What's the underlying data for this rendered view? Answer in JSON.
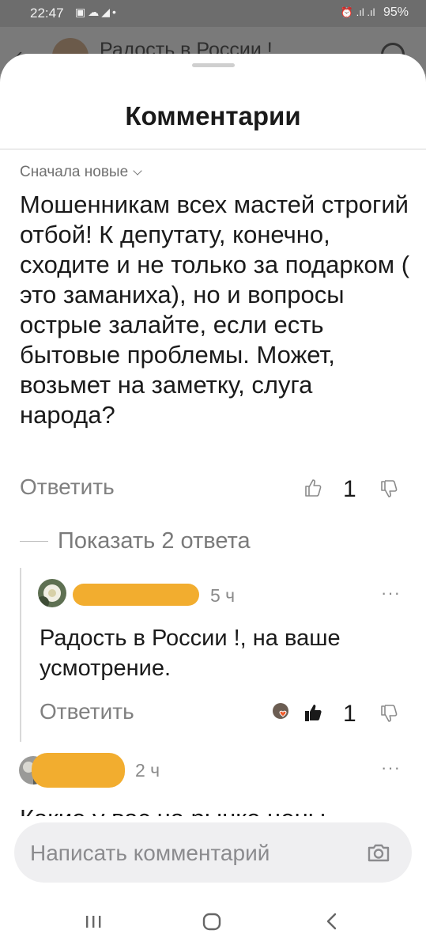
{
  "status_bar": {
    "time": "22:47",
    "left_icons": [
      "image-icon",
      "cloud-icon",
      "telegram-icon",
      "dot-icon"
    ],
    "battery": "95%"
  },
  "background_page": {
    "channel_title": "Радость  в России !"
  },
  "sheet": {
    "title": "Комментарии",
    "sort_label": "Сначала новые"
  },
  "top_comment": {
    "text": "Мошенникам всех мастей строгий отбой! К депутату, конечно, сходите и не только за подарком ( это заманиха), но и вопросы острые залайте, если есть бытовые проблемы. Может, возьмет на заметку, слуга народа?",
    "reply_label": "Ответить",
    "likes": "1",
    "show_replies_label": "Показать 2 ответа"
  },
  "nested_reply": {
    "time": "5 ч",
    "text": "Радость  в России !, на ваше усмотрение.",
    "reply_label": "Ответить",
    "likes": "1"
  },
  "next_comment": {
    "time": "2 ч",
    "text_partial": "Какие у вас на рынке цены"
  },
  "composer": {
    "placeholder": "Написать комментарий"
  },
  "colors": {
    "redaction": "#f2ad2f",
    "muted_text": "#808080",
    "input_bg": "#efeff1"
  }
}
